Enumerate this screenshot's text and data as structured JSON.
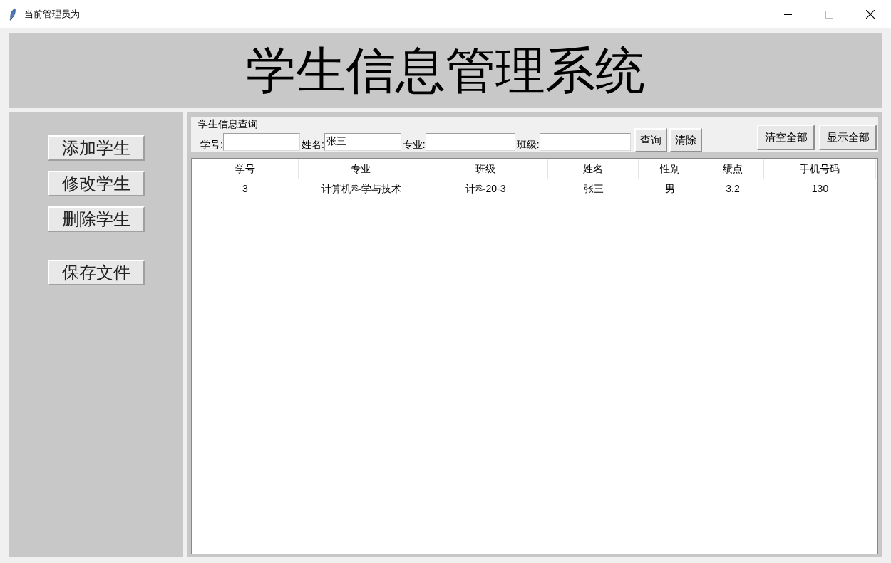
{
  "window": {
    "title": "当前管理员为"
  },
  "header": {
    "title": "学生信息管理系统"
  },
  "sidebar": {
    "button_groups": [
      [
        "添加学生",
        "修改学生",
        "删除学生"
      ],
      [
        "保存文件"
      ]
    ]
  },
  "query": {
    "title": "学生信息查询",
    "fields": [
      {
        "label": "学号:"
      },
      {
        "label": "姓名:",
        "value": "张三"
      },
      {
        "label": "专业:"
      },
      {
        "label": "班级:"
      }
    ],
    "buttons": [
      "查询",
      "清除"
    ],
    "extra_buttons": [
      "清空全部",
      "显示全部"
    ]
  },
  "table": {
    "columns": [
      "学号",
      "专业",
      "班级",
      "姓名",
      "性别",
      "绩点",
      "手机号码"
    ],
    "rows": [
      [
        "3",
        "计算机科学与技术",
        "计科20-3",
        "张三",
        "男",
        "3.2",
        "130"
      ]
    ]
  }
}
